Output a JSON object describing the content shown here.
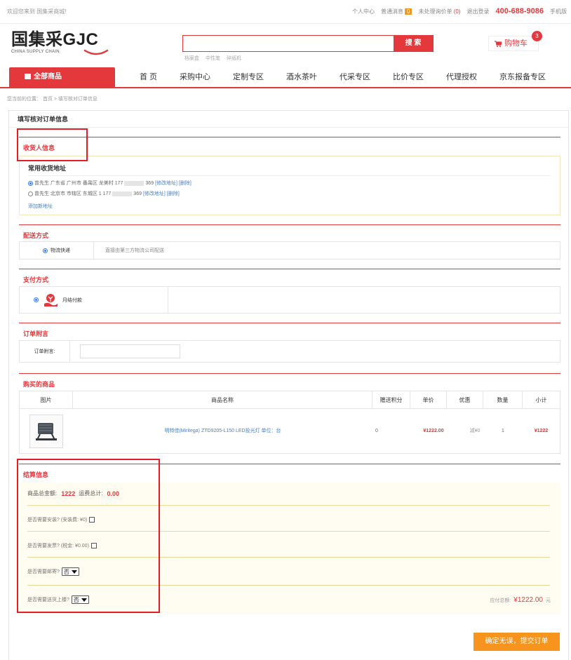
{
  "topbar": {
    "welcome": "欢迎您来到 国集采商城!",
    "personal_center": "个人中心",
    "messages_label": "普通消息",
    "messages_count": "0",
    "unhandled_label": "未处理询价单",
    "unhandled_count": "(0)",
    "logout": "退出登录",
    "phone": "400-688-9086",
    "mobile": "手机版"
  },
  "logo": {
    "cn": "国集采",
    "en": "GJC",
    "sub": "CHINA SUPPLY CHAIN"
  },
  "search": {
    "placeholder": "",
    "button": "搜 索",
    "hotwords": [
      "档案盒",
      "中性笔",
      "碎纸机"
    ]
  },
  "cart": {
    "label": "购物车",
    "count": "3"
  },
  "nav": {
    "all": "全部商品",
    "items": [
      "首 页",
      "采购中心",
      "定制专区",
      "酒水茶叶",
      "代采专区",
      "比价专区",
      "代理授权",
      "京东报备专区"
    ]
  },
  "breadcrumb": "您当前的位置： 首页 > 填写核对订单信息",
  "page_title": "填写核对订单信息",
  "consignee": {
    "title": "收货人信息",
    "common_address": "常用收货地址",
    "addresses": [
      {
        "text": "曾先生 广东省 广州市 番禺区 龙美村 177",
        "tail": "369",
        "edit": "[修改地址]",
        "del": "[删除]",
        "selected": true
      },
      {
        "text": "曾先生 北京市 市辖区 东城区 1 177",
        "tail": "369",
        "edit": "[修改地址]",
        "del": "[删除]",
        "selected": false
      }
    ],
    "add_address": "添加新地址"
  },
  "delivery": {
    "title": "配送方式",
    "option": "物流快递",
    "desc": "直接由第三方物流公司配送"
  },
  "payment": {
    "title": "支付方式",
    "option": "月结付款"
  },
  "remark": {
    "title": "订单附言",
    "label": "订单附言:",
    "value": ""
  },
  "goods": {
    "title": "购买的商品",
    "headers": [
      "图片",
      "商品名称",
      "赠送积分",
      "单价",
      "优惠",
      "数量",
      "小计"
    ],
    "rows": [
      {
        "name": "明特佳(Miritega) ZTD9205-L150 LED投光灯 单位：台",
        "points": "0",
        "price": "¥1222.00",
        "discount": "减¥0",
        "qty": "1",
        "subtotal": "¥1222"
      }
    ]
  },
  "settlement": {
    "title": "结算信息",
    "goods_total_label": "商品总金额:",
    "goods_total": "1222",
    "shipping_label": "运费总计:",
    "shipping": "0.00",
    "install_q": "是否需要安装? (安装费: ¥0)",
    "invoice_q": "是否需要发票? (税金: ¥0.00)",
    "post_q": "是否需要邮寄?",
    "post_value": "否",
    "upstairs_q": "是否需要送货上楼?",
    "upstairs_value": "否",
    "payable_label": "应付总额:",
    "payable": "¥1222.00",
    "payable_unit": "元"
  },
  "submit": "确定无误，提交订单",
  "colors": {
    "brand_red": "#e4393c",
    "submit_orange": "#f7941d",
    "annotation_red": "#e31e24"
  }
}
